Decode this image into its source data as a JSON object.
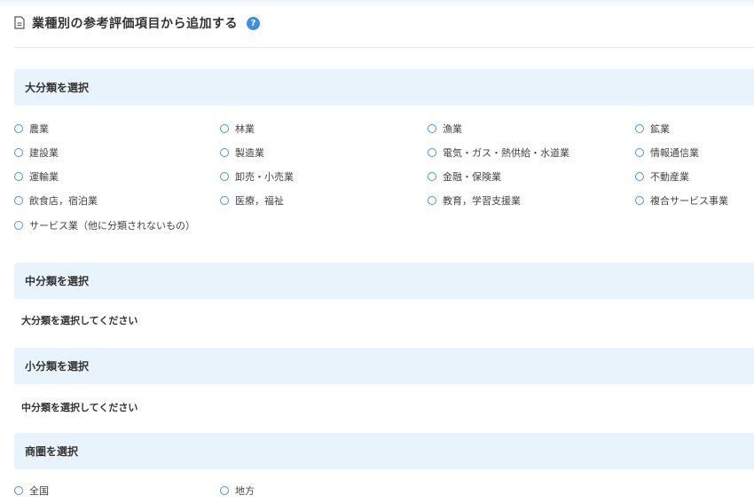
{
  "header": {
    "title": "業種別の参考評価項目から追加する",
    "help": "?"
  },
  "sections": {
    "major": {
      "label": "大分類を選択"
    },
    "middle": {
      "label": "中分類を選択",
      "hint": "大分類を選択してください"
    },
    "minor": {
      "label": "小分類を選択",
      "hint": "中分類を選択してください"
    },
    "area": {
      "label": "商圏を選択"
    }
  },
  "major_options": [
    "農業",
    "林業",
    "漁業",
    "鉱業",
    "建設業",
    "製造業",
    "電気・ガス・熱供給・水道業",
    "情報通信業",
    "運輸業",
    "卸売・小売業",
    "金融・保険業",
    "不動産業",
    "飲食店，宿泊業",
    "医療，福祉",
    "教育，学習支援業",
    "複合サービス事業",
    "サービス業（他に分類されないもの）"
  ],
  "area_options": [
    "全国",
    "地方"
  ],
  "colors": {
    "accent": "#3f8fdf",
    "section_bg": "#e9f3fb"
  }
}
